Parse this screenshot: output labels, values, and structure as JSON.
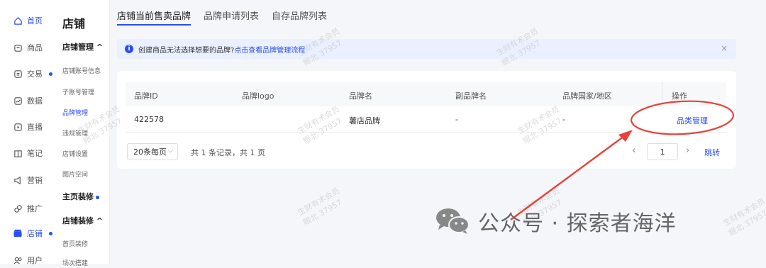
{
  "rail": {
    "items": [
      {
        "label": "首页",
        "icon": "home-icon",
        "active": true
      },
      {
        "label": "商品",
        "icon": "goods-icon"
      },
      {
        "label": "交易",
        "icon": "trade-icon",
        "dot": true
      },
      {
        "label": "数据",
        "icon": "data-icon"
      },
      {
        "label": "直播",
        "icon": "live-icon"
      },
      {
        "label": "笔记",
        "icon": "notes-icon"
      },
      {
        "label": "营销",
        "icon": "marketing-icon"
      },
      {
        "label": "推广",
        "icon": "promo-icon"
      },
      {
        "label": "店铺",
        "icon": "store-icon",
        "dot": true,
        "active": true
      },
      {
        "label": "用户",
        "icon": "user-icon"
      }
    ]
  },
  "submenu": {
    "title": "店铺",
    "groups": [
      {
        "label": "店铺管理 ^"
      },
      {
        "label": "主页装修"
      },
      {
        "label": "店铺装修 ^"
      }
    ],
    "items": [
      "店铺账号信息",
      "子账号管理",
      "品牌管理",
      "违规管理",
      "店铺设置",
      "图片空间",
      "首页装修",
      "场次搭建"
    ]
  },
  "tabs": [
    "店铺当前售卖品牌",
    "品牌申请列表",
    "自存品牌列表"
  ],
  "alert": {
    "text": "创建商品无法选择想要的品牌?",
    "link": "点击查看品牌管理流程",
    "close": "×"
  },
  "table": {
    "headers": [
      "品牌ID",
      "品牌logo",
      "品牌名",
      "副品牌名",
      "品牌国家/地区",
      "操作"
    ],
    "rows": [
      {
        "id": "422578",
        "logo": "",
        "name": "薯店品牌",
        "sub": "-",
        "country": "-",
        "action": "品类管理"
      }
    ]
  },
  "pagination": {
    "page_size": "20条每页",
    "summary": "共 1 条记录，共 1 页",
    "current_page": "1",
    "prev": "‹",
    "next": "›",
    "jump": "跳转"
  },
  "annotation": {
    "wechat_text": "公众号 · 探索者海洋",
    "watermark_line1": "生财有术会员",
    "watermark_line2": "眼北 37957",
    "color": "#e8413a"
  }
}
